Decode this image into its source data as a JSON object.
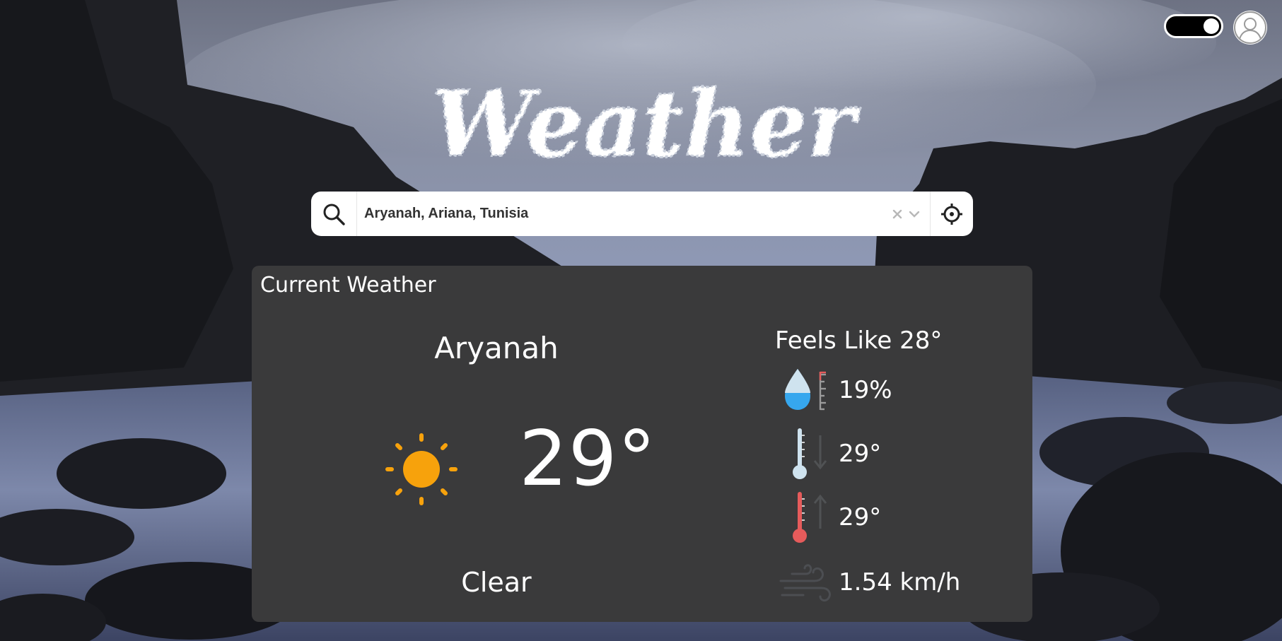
{
  "page": {
    "title": "Weather"
  },
  "header": {
    "theme_toggle_state": "on",
    "avatar_icon": "user-icon"
  },
  "search": {
    "value": "Aryanah, Ariana, Tunisia",
    "search_icon": "search-icon",
    "clear_icon": "close-icon",
    "dropdown_icon": "chevron-down-icon",
    "locate_icon": "crosshair-icon"
  },
  "current_weather": {
    "card_title": "Current Weather",
    "city": "Aryanah",
    "temperature": "29°",
    "condition": "Clear",
    "condition_icon": "sun-icon",
    "feels_like": "Feels Like 28°",
    "humidity": "19%",
    "humidity_icon": "humidity-icon",
    "temp_min": "29°",
    "temp_min_icon": "thermometer-low-icon",
    "temp_max": "29°",
    "temp_max_icon": "thermometer-high-icon",
    "wind": "1.54 km/h",
    "wind_icon": "wind-icon"
  },
  "colors": {
    "card_bg": "#3a3a3b",
    "sun": "#f7a20c",
    "water": "#36a7ee",
    "cold": "#cfe3ef",
    "hot": "#e65b5b"
  }
}
